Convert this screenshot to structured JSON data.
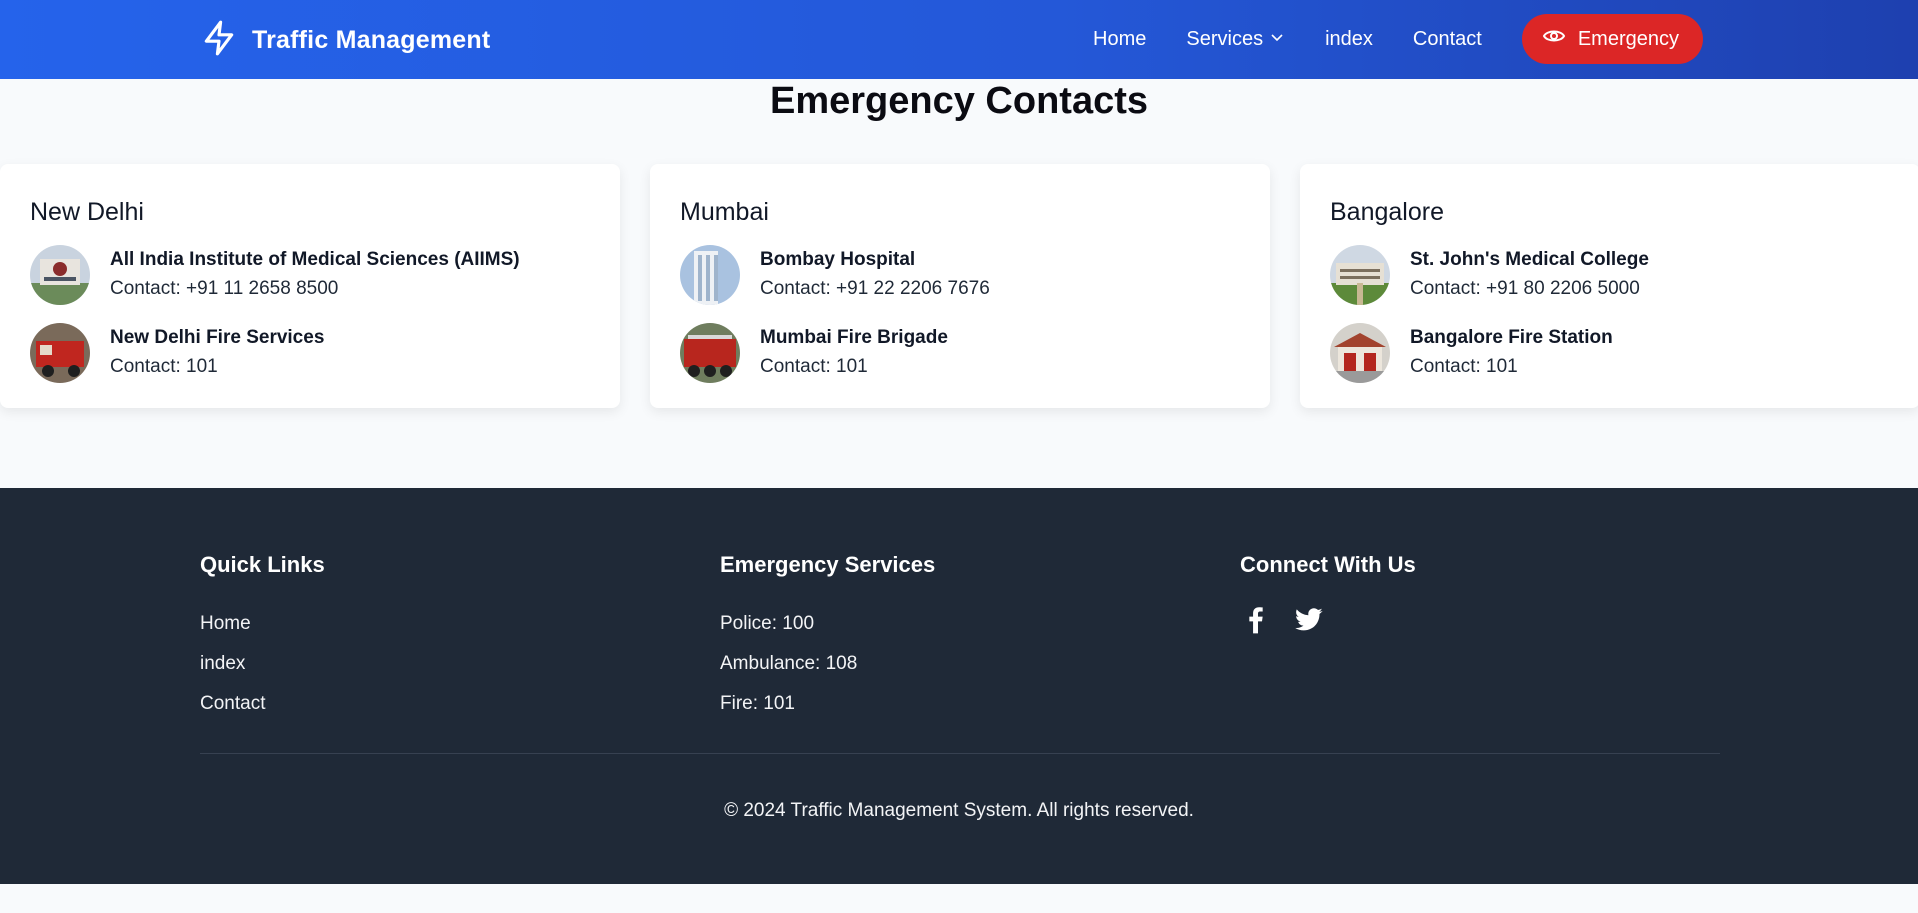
{
  "nav": {
    "brand": "Traffic Management",
    "links": [
      "Home",
      "Services",
      "index",
      "Contact"
    ],
    "emergency_button": "Emergency"
  },
  "page_title": "Emergency Contacts",
  "cards": [
    {
      "city": "New Delhi",
      "entries": [
        {
          "name": "All India Institute of Medical Sciences (AIIMS)",
          "contact": "Contact: +91 11 2658 8500"
        },
        {
          "name": "New Delhi Fire Services",
          "contact": "Contact: 101"
        }
      ]
    },
    {
      "city": "Mumbai",
      "entries": [
        {
          "name": "Bombay Hospital",
          "contact": "Contact: +91 22 2206 7676"
        },
        {
          "name": "Mumbai Fire Brigade",
          "contact": "Contact: 101"
        }
      ]
    },
    {
      "city": "Bangalore",
      "entries": [
        {
          "name": "St. John's Medical College",
          "contact": "Contact: +91 80 2206 5000"
        },
        {
          "name": "Bangalore Fire Station",
          "contact": "Contact: 101"
        }
      ]
    }
  ],
  "footer": {
    "quick_links": {
      "title": "Quick Links",
      "items": [
        "Home",
        "index",
        "Contact"
      ]
    },
    "emergency_services": {
      "title": "Emergency Services",
      "items": [
        "Police: 100",
        "Ambulance: 108",
        "Fire: 101"
      ]
    },
    "connect": {
      "title": "Connect With Us",
      "icons": [
        "facebook-icon",
        "twitter-icon"
      ]
    },
    "copyright": "© 2024 Traffic Management System. All rights reserved."
  },
  "colors": {
    "nav_gradient_start": "#2563eb",
    "nav_gradient_end": "#1e40af",
    "emergency": "#dc2626",
    "footer_bg": "#1f2937",
    "page_bg": "#f8fafc"
  }
}
